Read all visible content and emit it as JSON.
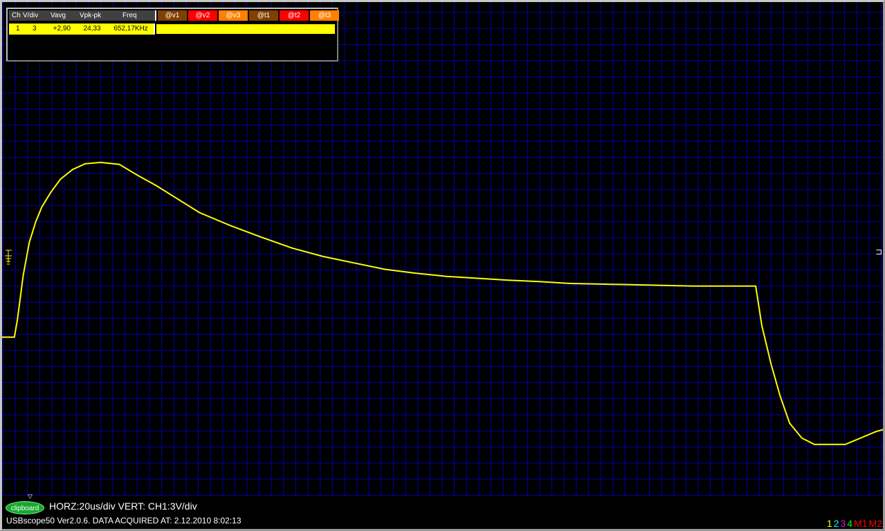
{
  "measurement_table": {
    "headers": [
      "Ch",
      "V/div",
      "Vavg",
      "Vpk-pk",
      "Freq"
    ],
    "cursor_buttons": [
      {
        "label": "@v1",
        "color": "#804000"
      },
      {
        "label": "@v2",
        "color": "#ff0000"
      },
      {
        "label": "@v3",
        "color": "#ff8000"
      },
      {
        "label": "@t1",
        "color": "#804000"
      },
      {
        "label": "@t2",
        "color": "#ff0000"
      },
      {
        "label": "@t3",
        "color": "#ff8000"
      }
    ],
    "row": {
      "ch": "1",
      "vdiv": "3",
      "vavg": "+2,90",
      "vpkpk": "24,33",
      "freq": "652,17KHz"
    }
  },
  "status": {
    "clipboard_label": "clipboard",
    "horz_vert": "HORZ:20us/div VERT: CH1:3V/div",
    "version_line": "USBscope50 Ver2.0.6.   DATA ACQUIRED AT: 2.12.2010 8:02:13"
  },
  "channel_selector": [
    {
      "label": "1",
      "color": "#ffff00"
    },
    {
      "label": "2",
      "color": "#00ffff"
    },
    {
      "label": "3",
      "color": "#ff00ff"
    },
    {
      "label": "4",
      "color": "#00ff00"
    },
    {
      "label": "M1",
      "color": "#ff0000"
    },
    {
      "label": "M2",
      "color": "#ff0000"
    }
  ],
  "colors": {
    "background": "#000000",
    "grid": "#0000aa",
    "trace_ch1": "#ffff00"
  },
  "chart_data": {
    "type": "line",
    "title": "",
    "xlabel": "",
    "ylabel": "",
    "grid": true,
    "x_unit": "us",
    "y_unit": "V",
    "xlim": [
      -4.35,
      284.6
    ],
    "ylim": [
      -15.04,
      30.96
    ],
    "series": [
      {
        "color": "#ffff00",
        "x": [
          -4.35,
          -0.3,
          0.7,
          2.6,
          4.6,
          6.7,
          8.7,
          11.7,
          14.8,
          18.8,
          22.9,
          28.0,
          34.1,
          40.1,
          46.2,
          52.3,
          60.4,
          70.5,
          80.6,
          90.8,
          100.9,
          111.0,
          121.2,
          131.3,
          141.4,
          151.6,
          161.7,
          171.9,
          182.0,
          192.1,
          202.3,
          212.4,
          222.5,
          232.7,
          242.8,
          242.85,
          244.9,
          247.9,
          250.9,
          254.0,
          258.0,
          262.1,
          267.2,
          272.2,
          277.3,
          282.3,
          284.6
        ],
        "y": [
          -0.26,
          -0.26,
          1.38,
          5.52,
          8.58,
          10.5,
          11.88,
          13.26,
          14.46,
          15.36,
          15.9,
          16.02,
          15.84,
          14.82,
          13.86,
          12.78,
          11.34,
          10.14,
          9.06,
          8.04,
          7.26,
          6.66,
          6.06,
          5.7,
          5.4,
          5.22,
          5.04,
          4.92,
          4.74,
          4.68,
          4.62,
          4.56,
          4.5,
          4.5,
          4.5,
          4.5,
          0.78,
          -2.76,
          -5.76,
          -8.28,
          -9.66,
          -10.26,
          -10.26,
          -10.26,
          -9.66,
          -9.06,
          -8.88
        ]
      }
    ]
  }
}
